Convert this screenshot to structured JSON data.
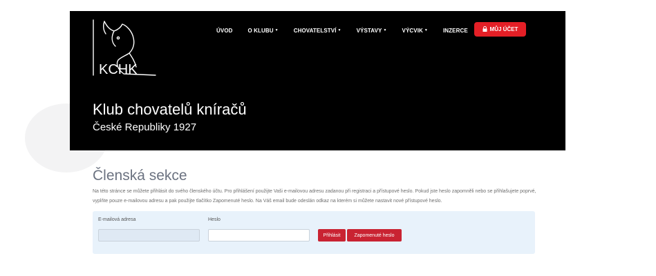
{
  "header": {
    "logo_text": "KCHK",
    "nav": [
      {
        "label": "ÚVOD",
        "dropdown": false
      },
      {
        "label": "O KLUBU",
        "dropdown": true
      },
      {
        "label": "CHOVATELSTVÍ",
        "dropdown": true
      },
      {
        "label": "VÝSTAVY",
        "dropdown": true
      },
      {
        "label": "VÝCVIK",
        "dropdown": true
      },
      {
        "label": "INZERCE",
        "dropdown": false
      }
    ],
    "account_button": {
      "label": "MŮJ ÚČET",
      "icon": "lock-icon"
    },
    "title": "Klub chovatelů kníračů",
    "subtitle": "České Republiky 1927"
  },
  "main": {
    "section_title": "Členská sekce",
    "intro_text": "Na této stránce se můžete přihlásit do svého členského účtu. Pro přihlášení použijte Vaši e-mailovou adresu zadanou při registraci a přístupové heslo. Pokud jste heslo zapomněli nebo se přihlašujete poprvé, vyplňte pouze e-mailovou adresu a pak použijte tlačítko Zapomenuté heslo. Na Váš email bude odeslán odkaz na kterém si můžete nastavit nové přístupové heslo.",
    "form": {
      "email_label": "E-mailová adresa",
      "email_value": "",
      "password_label": "Heslo",
      "password_value": "",
      "login_label": "Přihlásit",
      "forgot_label": "Zapomenuté heslo"
    }
  },
  "colors": {
    "hero_bg": "#000000",
    "accent": "#e41f26",
    "button": "#c92332",
    "panel": "#e8f2fb"
  }
}
